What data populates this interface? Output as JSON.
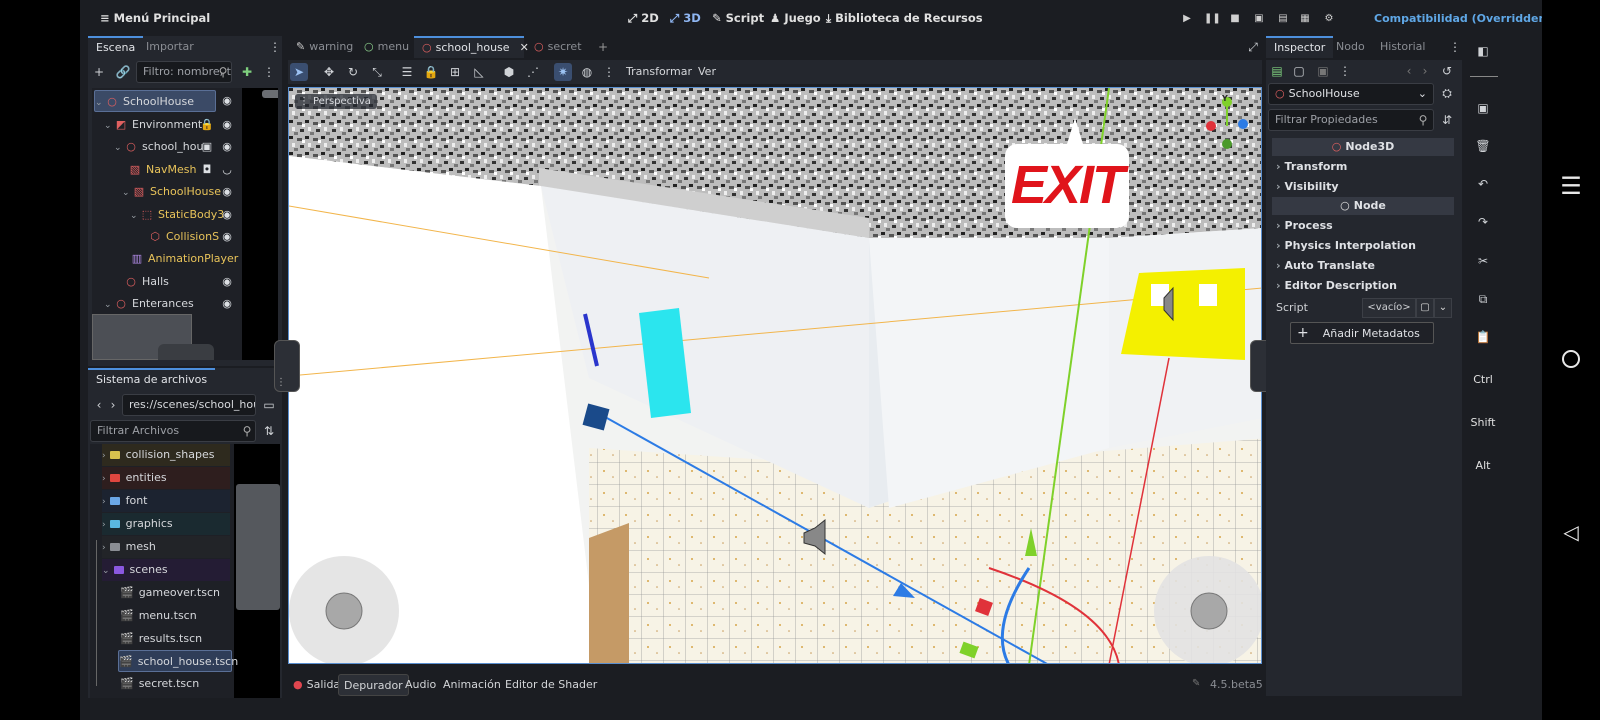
{
  "topbar": {
    "menu_label": "Menú Principal",
    "btn_2d": "2D",
    "btn_3d": "3D",
    "btn_script": "Script",
    "btn_game": "Juego",
    "btn_assets": "Biblioteca de Recursos",
    "renderer": "Compatibilidad (Overridden)"
  },
  "scene_dock": {
    "tabs": [
      "Escena",
      "Importar"
    ],
    "filter_placeholder": "Filtro: nombre, t",
    "tree": [
      {
        "label": "SchoolHouse",
        "selected": true
      },
      {
        "label": "Environment"
      },
      {
        "label": "school_hou"
      },
      {
        "label": "NavMesh"
      },
      {
        "label": "SchoolHouse"
      },
      {
        "label": "StaticBody3"
      },
      {
        "label": "CollisionS"
      },
      {
        "label": "AnimationPlayer"
      },
      {
        "label": "Halls"
      },
      {
        "label": "Enterances"
      }
    ]
  },
  "filesystem": {
    "title": "Sistema de archivos",
    "path": "res://scenes/school_house.",
    "filter_placeholder": "Filtrar Archivos",
    "items": [
      {
        "label": "collision_shapes",
        "color": "#d9c24e"
      },
      {
        "label": "entities",
        "color": "#e0463f"
      },
      {
        "label": "font",
        "color": "#6aa7e6"
      },
      {
        "label": "graphics",
        "color": "#5ab7e0"
      },
      {
        "label": "mesh",
        "color": "#8a8d93"
      },
      {
        "label": "scenes",
        "color": "#8a58e0"
      },
      {
        "label": "gameover.tscn"
      },
      {
        "label": "menu.tscn"
      },
      {
        "label": "results.tscn"
      },
      {
        "label": "school_house.tscn",
        "selected": true
      },
      {
        "label": "secret.tscn"
      }
    ]
  },
  "editor_tabs": [
    "warning",
    "menu",
    "school_house",
    "secret"
  ],
  "toolbar": {
    "transform_label": "Transformar",
    "view_label": "Ver"
  },
  "viewport": {
    "perspective_label": "Perspectiva",
    "exit_sign": "EXIT",
    "axis_y": "Y"
  },
  "inspector": {
    "tabs": [
      "Inspector",
      "Nodo",
      "Historial"
    ],
    "node_select": "SchoolHouse",
    "filter_placeholder": "Filtrar Propiedades",
    "section_node3d": "Node3D",
    "groups_node3d": [
      "Transform",
      "Visibility"
    ],
    "section_node": "Node",
    "groups_node": [
      "Process",
      "Physics Interpolation",
      "Auto Translate",
      "Editor Description"
    ],
    "script_label": "Script",
    "script_value": "<vacío>",
    "add_metadata": "Añadir Metadatos"
  },
  "bottom_panel": {
    "tabs": [
      "Salida",
      "Depurador",
      "Audio",
      "Animación",
      "Editor de Shader"
    ],
    "version": "4.5.beta5"
  },
  "android_bar": {
    "keys": [
      "Ctrl",
      "Shift",
      "Alt"
    ]
  },
  "colors": {
    "accent": "#4d8fdc",
    "bg": "#1b1d22",
    "panel": "#24272e",
    "exit_red": "#e0141b"
  }
}
